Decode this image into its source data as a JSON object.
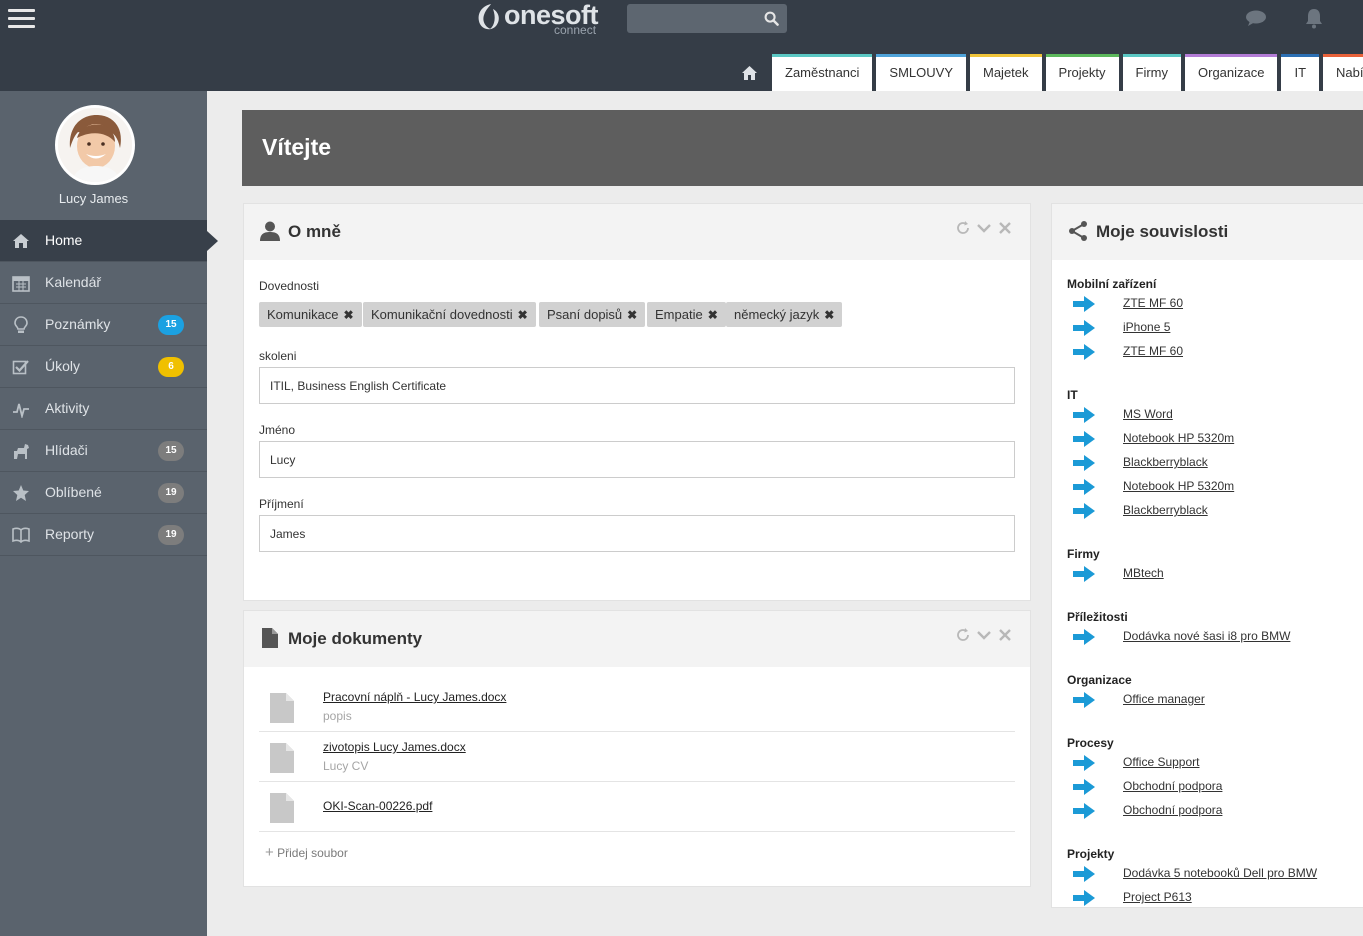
{
  "header": {
    "logo_text": "onesoft",
    "logo_sub": "connect",
    "search_placeholder": "",
    "tabs": [
      {
        "label": "Zaměstnanci",
        "color": "#5bc8c4"
      },
      {
        "label": "SMLOUVY",
        "color": "#4fa3d9"
      },
      {
        "label": "Majetek",
        "color": "#f0c43a"
      },
      {
        "label": "Projekty",
        "color": "#5cb85c"
      },
      {
        "label": "Firmy",
        "color": "#5bc8c4"
      },
      {
        "label": "Organizace",
        "color": "#b37cd6"
      },
      {
        "label": "IT",
        "color": "#2c6fb3"
      },
      {
        "label": "Nabídk",
        "color": "#e8623a"
      }
    ]
  },
  "user": {
    "name": "Lucy James"
  },
  "nav": [
    {
      "label": "Home",
      "icon": "home-icon",
      "badge": "",
      "active": true
    },
    {
      "label": "Kalendář",
      "icon": "calendar-icon",
      "badge": ""
    },
    {
      "label": "Poznámky",
      "icon": "lightbulb-icon",
      "badge": "15",
      "badge_color": "#1ba1e2"
    },
    {
      "label": "Úkoly",
      "icon": "checkbox-icon",
      "badge": "6",
      "badge_color": "#f0c000"
    },
    {
      "label": "Aktivity",
      "icon": "activity-icon",
      "badge": ""
    },
    {
      "label": "Hlídači",
      "icon": "dog-icon",
      "badge": "15",
      "badge_color": "#7d7d7d"
    },
    {
      "label": "Oblíbené",
      "icon": "star-icon",
      "badge": "19",
      "badge_color": "#7d7d7d"
    },
    {
      "label": "Reporty",
      "icon": "book-icon",
      "badge": "19",
      "badge_color": "#7d7d7d"
    }
  ],
  "banner": {
    "title": "Vítejte"
  },
  "about": {
    "title": "O mně",
    "skills_label": "Dovednosti",
    "skills": [
      "Komunikace",
      "Komunikační dovednosti",
      "Psaní dopisů",
      "Empatie",
      "německý jazyk"
    ],
    "training_label": "skoleni",
    "training_value": "ITIL, Business English Certificate",
    "first_name_label": "Jméno",
    "first_name_value": "Lucy",
    "last_name_label": "Příjmení",
    "last_name_value": "James"
  },
  "documents": {
    "title": "Moje dokumenty",
    "items": [
      {
        "name": "Pracovní náplň - Lucy James.docx",
        "desc": "popis"
      },
      {
        "name": "zivotopis Lucy James.docx",
        "desc": "Lucy CV"
      },
      {
        "name": "OKI-Scan-00226.pdf",
        "desc": ""
      }
    ],
    "add_label": "Přidej soubor"
  },
  "relations": {
    "title": "Moje souvislosti",
    "groups": [
      {
        "title": "Mobilní zařízení",
        "items": [
          "ZTE MF 60",
          "iPhone 5",
          "ZTE MF 60"
        ]
      },
      {
        "title": "IT",
        "items": [
          "MS Word",
          "Notebook HP 5320m",
          "Blackberryblack",
          "Notebook HP 5320m",
          "Blackberryblack"
        ]
      },
      {
        "title": "Firmy",
        "items": [
          "MBtech"
        ]
      },
      {
        "title": "Příležitosti",
        "items": [
          "Dodávka nové šasi i8 pro BMW"
        ]
      },
      {
        "title": "Organizace",
        "items": [
          "Office manager"
        ]
      },
      {
        "title": "Procesy",
        "items": [
          "Office Support",
          "Obchodní podpora",
          "Obchodní podpora"
        ]
      },
      {
        "title": "Projekty",
        "items": [
          "Dodávka 5 notebooků Dell pro BMW",
          "Project P613"
        ]
      }
    ]
  }
}
